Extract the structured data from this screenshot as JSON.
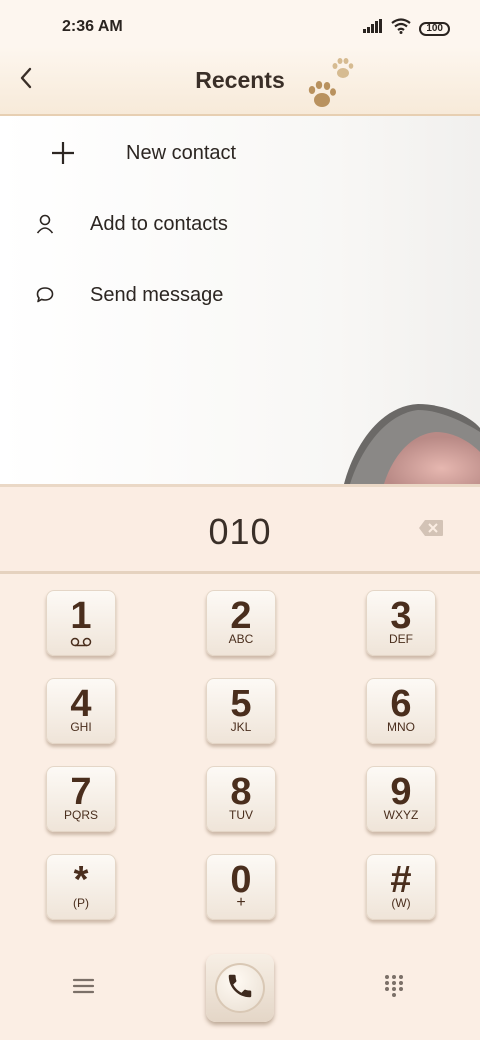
{
  "status_bar": {
    "time": "2:36 AM",
    "battery": "100",
    "icons": [
      "signal-icon",
      "wifi-icon",
      "battery-icon"
    ]
  },
  "header": {
    "title": "Recents",
    "back_icon": "chevron-left-icon",
    "decoration": "paw-prints"
  },
  "actions": [
    {
      "label": "New contact",
      "icon": "plus-icon"
    },
    {
      "label": "Add to contacts",
      "icon": "person-icon"
    },
    {
      "label": "Send message",
      "icon": "chat-bubble-icon"
    }
  ],
  "dialer": {
    "number": "010",
    "backspace_icon": "backspace-icon"
  },
  "keypad": [
    {
      "digit": "1",
      "letters": "voicemail"
    },
    {
      "digit": "2",
      "letters": "ABC"
    },
    {
      "digit": "3",
      "letters": "DEF"
    },
    {
      "digit": "4",
      "letters": "GHI"
    },
    {
      "digit": "5",
      "letters": "JKL"
    },
    {
      "digit": "6",
      "letters": "MNO"
    },
    {
      "digit": "7",
      "letters": "PQRS"
    },
    {
      "digit": "8",
      "letters": "TUV"
    },
    {
      "digit": "9",
      "letters": "WXYZ"
    },
    {
      "digit": "*",
      "letters": "(P)"
    },
    {
      "digit": "0",
      "letters": "+"
    },
    {
      "digit": "#",
      "letters": "(W)"
    }
  ],
  "bottom_bar": {
    "menu_icon": "hamburger-icon",
    "call_icon": "phone-icon",
    "dialpad_icon": "dialpad-icon"
  },
  "colors": {
    "accent_brown": "#4a2e1d",
    "keypad_bg": "#fbeee4",
    "divider": "#e7cfb2"
  }
}
